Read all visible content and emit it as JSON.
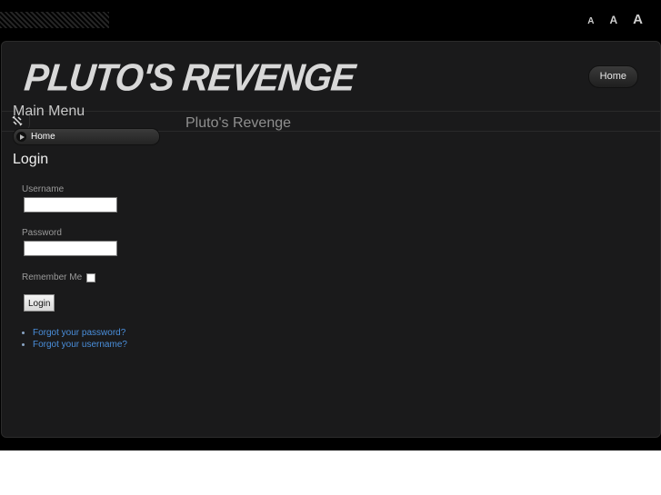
{
  "font_sizer": {
    "small": "A",
    "medium": "A",
    "large": "A"
  },
  "header": {
    "logo_text": "Pluto's Revenge",
    "nav_home": "Home"
  },
  "toolbar": {
    "icon": "tools-icon"
  },
  "sidebar": {
    "main_menu_title": "Main Menu",
    "menu_items": [
      {
        "label": "Home"
      }
    ],
    "login_title": "Login",
    "username_label": "Username",
    "username_value": "",
    "password_label": "Password",
    "password_value": "",
    "remember_label": "Remember Me",
    "login_button": "Login",
    "links": [
      "Forgot your password?",
      "Forgot your username?"
    ]
  },
  "main": {
    "title": "Pluto's Revenge"
  },
  "colors": {
    "background": "#000000",
    "panel": "#1a1a1b",
    "link": "#4a8fdc"
  }
}
